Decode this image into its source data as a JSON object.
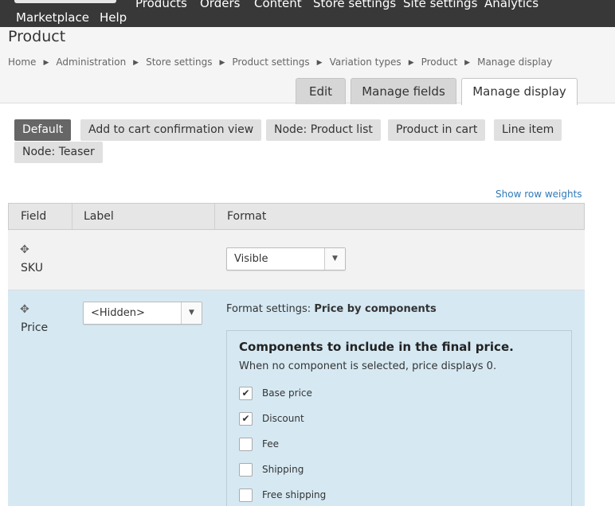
{
  "topnav": {
    "row1": [
      "Products",
      "Orders",
      "Content",
      "Store settings",
      "Site settings",
      "Analytics"
    ],
    "row2": [
      "Marketplace",
      "Help"
    ]
  },
  "page_title": "Product",
  "breadcrumb": [
    "Home",
    "Administration",
    "Store settings",
    "Product settings",
    "Variation types",
    "Product",
    "Manage display"
  ],
  "breadcrumb_sep": "▶",
  "tabs": [
    {
      "label": "Edit",
      "active": false
    },
    {
      "label": "Manage fields",
      "active": false
    },
    {
      "label": "Manage display",
      "active": true
    }
  ],
  "view_modes": [
    {
      "label": "Default",
      "active": true
    },
    {
      "label": "Add to cart confirmation view",
      "active": false
    },
    {
      "label": "Node: Product list",
      "active": false
    },
    {
      "label": "Product in cart",
      "active": false
    },
    {
      "label": "Line item",
      "active": false
    },
    {
      "label": "Node: Teaser",
      "active": false
    }
  ],
  "show_row_weights": "Show row weights",
  "table": {
    "headers": [
      "Field",
      "Label",
      "Format"
    ],
    "rows": [
      {
        "field": "SKU",
        "label": "",
        "format": "Visible"
      },
      {
        "field": "Price",
        "label": "<Hidden>",
        "format": ""
      }
    ]
  },
  "format_settings": {
    "prefix": "Format settings:",
    "name": "Price by components"
  },
  "components": {
    "title": "Components to include in the final price.",
    "description": "When no component is selected, price displays 0.",
    "items": [
      {
        "label": "Base price",
        "checked": true
      },
      {
        "label": "Discount",
        "checked": true
      },
      {
        "label": "Fee",
        "checked": false
      },
      {
        "label": "Shipping",
        "checked": false
      },
      {
        "label": "Free shipping",
        "checked": false
      }
    ]
  },
  "icons": {
    "drag": "move-icon",
    "dropdown": "chevron-down-icon",
    "check": "check-icon",
    "breadcrumb_sep": "triangle-right-icon"
  },
  "colors": {
    "topbar": "#383838",
    "active_tab_bg": "#ffffff",
    "active_view_mode": "#666666",
    "link": "#2f7ab8",
    "selected_row": "#d6e9f3"
  }
}
